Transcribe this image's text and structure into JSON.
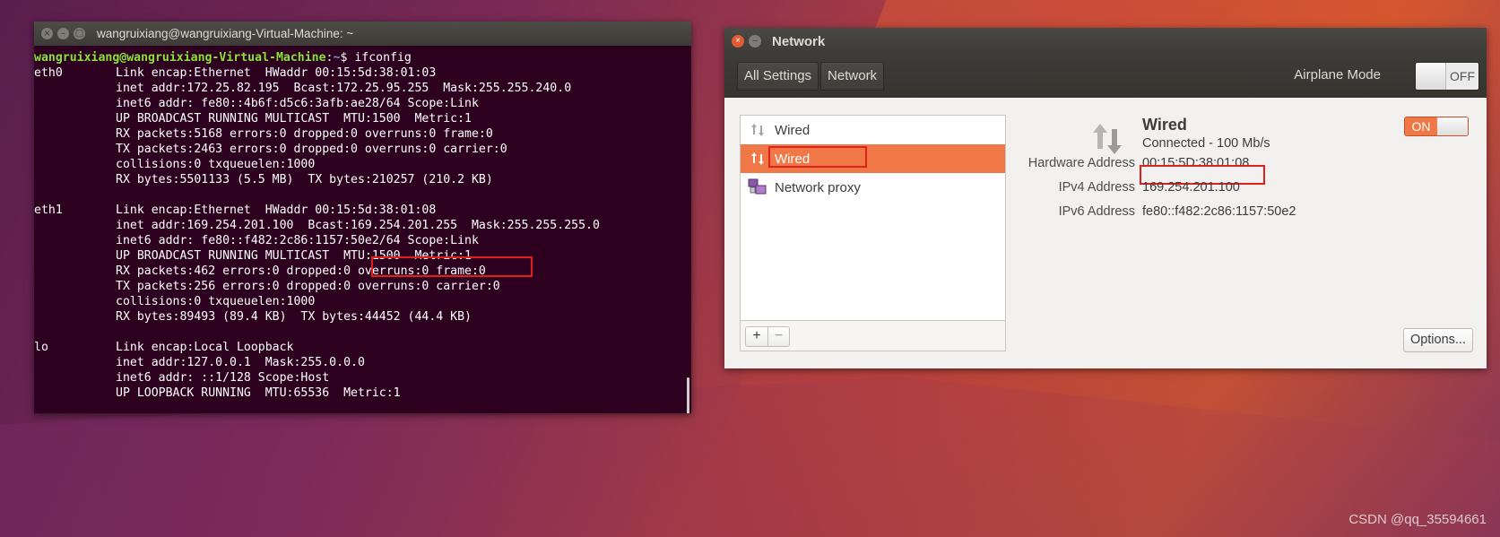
{
  "terminal": {
    "title": "wangruixiang@wangruixiang-Virtual-Machine: ~",
    "prompt": {
      "user": "wangruixiang@wangruixiang-Virtual-Machine",
      "sep": ":",
      "path": "~",
      "symbol": "$ ",
      "command": "ifconfig"
    },
    "lines": [
      {
        "iface": "eth0",
        "text": "Link encap:Ethernet  HWaddr 00:15:5d:38:01:03"
      },
      {
        "iface": "",
        "text": "inet addr:172.25.82.195  Bcast:172.25.95.255  Mask:255.255.240.0"
      },
      {
        "iface": "",
        "text": "inet6 addr: fe80::4b6f:d5c6:3afb:ae28/64 Scope:Link"
      },
      {
        "iface": "",
        "text": "UP BROADCAST RUNNING MULTICAST  MTU:1500  Metric:1"
      },
      {
        "iface": "",
        "text": "RX packets:5168 errors:0 dropped:0 overruns:0 frame:0"
      },
      {
        "iface": "",
        "text": "TX packets:2463 errors:0 dropped:0 overruns:0 carrier:0"
      },
      {
        "iface": "",
        "text": "collisions:0 txqueuelen:1000"
      },
      {
        "iface": "",
        "text": "RX bytes:5501133 (5.5 MB)  TX bytes:210257 (210.2 KB)"
      },
      {
        "iface": "",
        "text": ""
      },
      {
        "iface": "eth1",
        "text": "Link encap:Ethernet  HWaddr 00:15:5d:38:01:08"
      },
      {
        "iface": "",
        "text": "inet addr:169.254.201.100  Bcast:169.254.201.255  Mask:255.255.255.0"
      },
      {
        "iface": "",
        "text": "inet6 addr: fe80::f482:2c86:1157:50e2/64 Scope:Link"
      },
      {
        "iface": "",
        "text": "UP BROADCAST RUNNING MULTICAST  MTU:1500  Metric:1"
      },
      {
        "iface": "",
        "text": "RX packets:462 errors:0 dropped:0 overruns:0 frame:0"
      },
      {
        "iface": "",
        "text": "TX packets:256 errors:0 dropped:0 overruns:0 carrier:0"
      },
      {
        "iface": "",
        "text": "collisions:0 txqueuelen:1000"
      },
      {
        "iface": "",
        "text": "RX bytes:89493 (89.4 KB)  TX bytes:44452 (44.4 KB)"
      },
      {
        "iface": "",
        "text": ""
      },
      {
        "iface": "lo",
        "text": "Link encap:Local Loopback"
      },
      {
        "iface": "",
        "text": "inet addr:127.0.0.1  Mask:255.0.0.0"
      },
      {
        "iface": "",
        "text": "inet6 addr: ::1/128 Scope:Host"
      },
      {
        "iface": "",
        "text": "UP LOOPBACK RUNNING  MTU:65536  Metric:1"
      }
    ]
  },
  "network": {
    "title": "Network",
    "toolbar": {
      "all_settings": "All Settings",
      "network": "Network",
      "airplane_label": "Airplane Mode",
      "airplane_state": "OFF"
    },
    "list": [
      {
        "label": "Wired",
        "icon": "wired-icon"
      },
      {
        "label": "Wired",
        "icon": "wired-icon"
      },
      {
        "label": "Network proxy",
        "icon": "network-proxy-icon"
      }
    ],
    "footer": {
      "add": "+",
      "remove": "−"
    },
    "detail": {
      "name": "Wired",
      "status": "Connected - 100 Mb/s",
      "toggle": "ON",
      "props": [
        {
          "label": "Hardware Address",
          "value": "00:15:5D:38:01:08"
        },
        {
          "label": "IPv4 Address",
          "value": "169.254.201.100"
        },
        {
          "label": "IPv6 Address",
          "value": "fe80::f482:2c86:1157:50e2"
        }
      ],
      "options": "Options..."
    }
  },
  "watermark": "CSDN @qq_35594661",
  "colors": {
    "terminal_bg": "#2c001e",
    "accent": "#f07746",
    "highlight": "#e0201c",
    "prompt_user": "#8ae234",
    "prompt_path": "#729fcf"
  }
}
